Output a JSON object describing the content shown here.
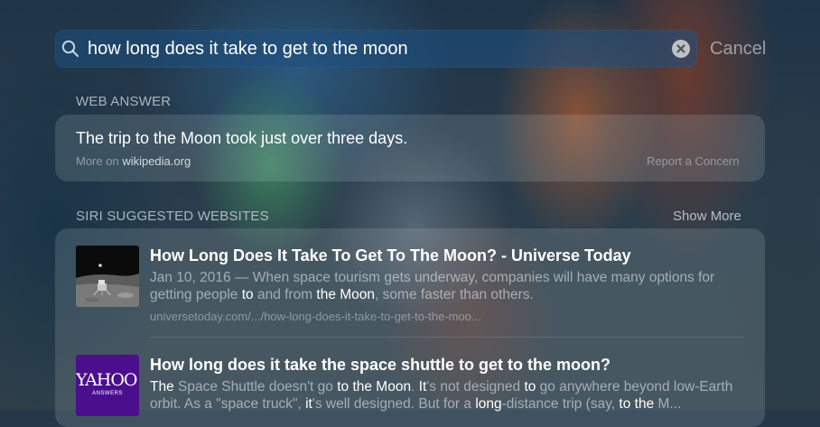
{
  "search": {
    "query": "how long does it take to get to the moon",
    "cancel_label": "Cancel"
  },
  "web_answer": {
    "header": "WEB ANSWER",
    "answer": "The trip to the Moon took just over three days.",
    "more_on_prefix": "More on ",
    "source": "wikipedia.org",
    "report_label": "Report a Concern"
  },
  "suggested": {
    "header": "SIRI SUGGESTED WEBSITES",
    "show_more_label": "Show More",
    "results": [
      {
        "title": "How Long Does It Take To Get To The Moon? - Universe Today",
        "date": "Jan 10, 2016 — ",
        "desc_parts": [
          "When space tourism gets underway, companies will have many options for getting people ",
          "to",
          " and from ",
          "the Moon",
          ", some faster than others."
        ],
        "url": "universetoday.com/.../how-long-does-it-take-to-get-to-the-moo..."
      },
      {
        "title": "How long does it take the space shuttle to get to the moon?",
        "desc_parts": [
          "The",
          " Space Shuttle doesn't go ",
          "to",
          " ",
          "the Moon",
          ". ",
          "It",
          "'s not designed ",
          "to",
          " go anywhere beyond low-Earth orbit. As a \"space truck\", ",
          "it",
          "'s well designed. But for a ",
          "long",
          "-distance trip (say, ",
          "to the",
          " M..."
        ],
        "thumb_label": "YAHOO!",
        "thumb_sublabel": "ANSWERS"
      }
    ]
  }
}
